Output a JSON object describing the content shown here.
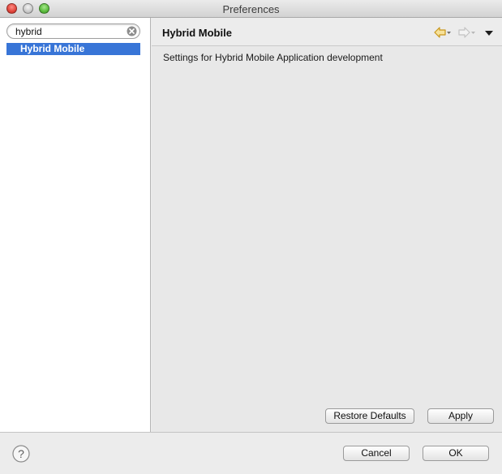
{
  "window": {
    "title": "Preferences"
  },
  "filter": {
    "value": "hybrid"
  },
  "tree": {
    "items": [
      {
        "label": "Hybrid Mobile",
        "selected": true
      }
    ]
  },
  "page": {
    "title": "Hybrid Mobile",
    "description": "Settings for Hybrid Mobile Application development",
    "restore_defaults_label": "Restore Defaults",
    "apply_label": "Apply"
  },
  "footer": {
    "cancel_label": "Cancel",
    "ok_label": "OK"
  },
  "icons": {
    "back": "back-arrow-icon",
    "forward": "forward-arrow-icon",
    "view_menu": "view-menu-icon",
    "help": "help-icon",
    "clear": "clear-search-icon"
  },
  "colors": {
    "selection": "#3875d7",
    "back_arrow": "#e3b21a"
  }
}
